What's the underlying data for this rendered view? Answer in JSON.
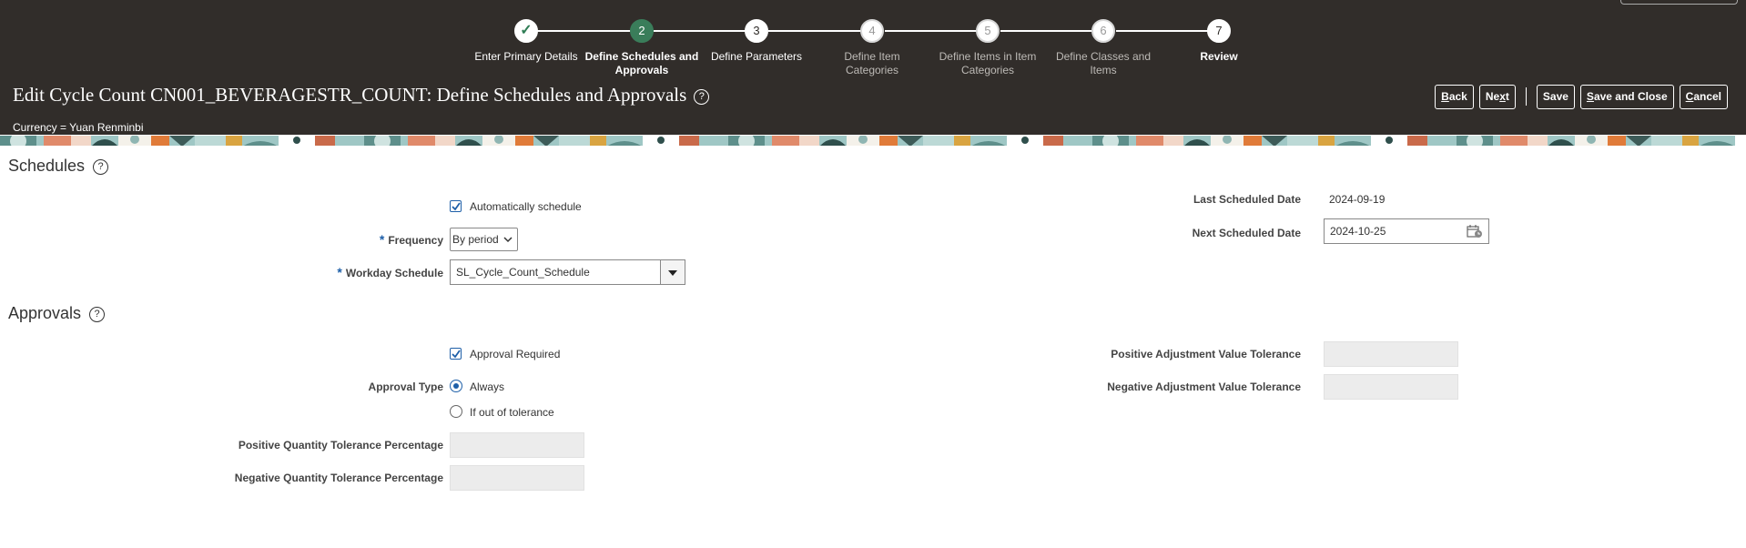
{
  "train": {
    "steps": [
      {
        "number": "",
        "label_lines": [
          "Enter Primary Details"
        ],
        "state": "done"
      },
      {
        "number": "2",
        "label_lines": [
          "Define Schedules and",
          "Approvals"
        ],
        "state": "current"
      },
      {
        "number": "3",
        "label_lines": [
          "Define Parameters"
        ],
        "state": "normal"
      },
      {
        "number": "4",
        "label_lines": [
          "Define Item",
          "Categories"
        ],
        "state": "disabled"
      },
      {
        "number": "5",
        "label_lines": [
          "Define Items in Item",
          "Categories"
        ],
        "state": "disabled"
      },
      {
        "number": "6",
        "label_lines": [
          "Define Classes and",
          "Items"
        ],
        "state": "disabled"
      },
      {
        "number": "7",
        "label_lines": [
          "Review"
        ],
        "state": "normal"
      }
    ]
  },
  "header": {
    "title": "Edit Cycle Count CN001_BEVERAGESTR_COUNT: Define Schedules and Approvals",
    "help_symbol": "?",
    "currency": "Currency = Yuan Renminbi",
    "actions": {
      "back": {
        "accesskey": "B",
        "rest": "ack"
      },
      "next": {
        "before": "Ne",
        "accesskey": "x",
        "rest": "t"
      },
      "save": "Save",
      "save_close": {
        "accesskey": "S",
        "rest": "ave and Close"
      },
      "cancel": {
        "accesskey": "C",
        "rest": "ancel"
      }
    }
  },
  "schedules": {
    "title": "Schedules",
    "help_symbol": "?",
    "auto_schedule_label": "Automatically schedule",
    "auto_schedule_checked": true,
    "required_marker": "*",
    "frequency_label": "Frequency",
    "frequency_value": "By period",
    "workday_label": "Workday Schedule",
    "workday_value": "SL_Cycle_Count_Schedule",
    "last_date_label": "Last Scheduled Date",
    "last_date_value": "2024-09-19",
    "next_date_label": "Next Scheduled Date",
    "next_date_value": "2024-10-25"
  },
  "approvals": {
    "title": "Approvals",
    "help_symbol": "?",
    "approval_required_label": "Approval Required",
    "approval_required_checked": true,
    "approval_type_label": "Approval Type",
    "option_always": "Always",
    "option_out_of_tolerance": "If out of tolerance",
    "selected_option": "Always",
    "pos_qty_label": "Positive Quantity Tolerance Percentage",
    "neg_qty_label": "Negative Quantity Tolerance Percentage",
    "pos_adj_label": "Positive Adjustment Value Tolerance",
    "neg_adj_label": "Negative Adjustment Value Tolerance"
  },
  "colors": {
    "header_bg": "#312d2a",
    "current_step": "#3a7d5a",
    "accent_blue": "#1e5fa8"
  }
}
